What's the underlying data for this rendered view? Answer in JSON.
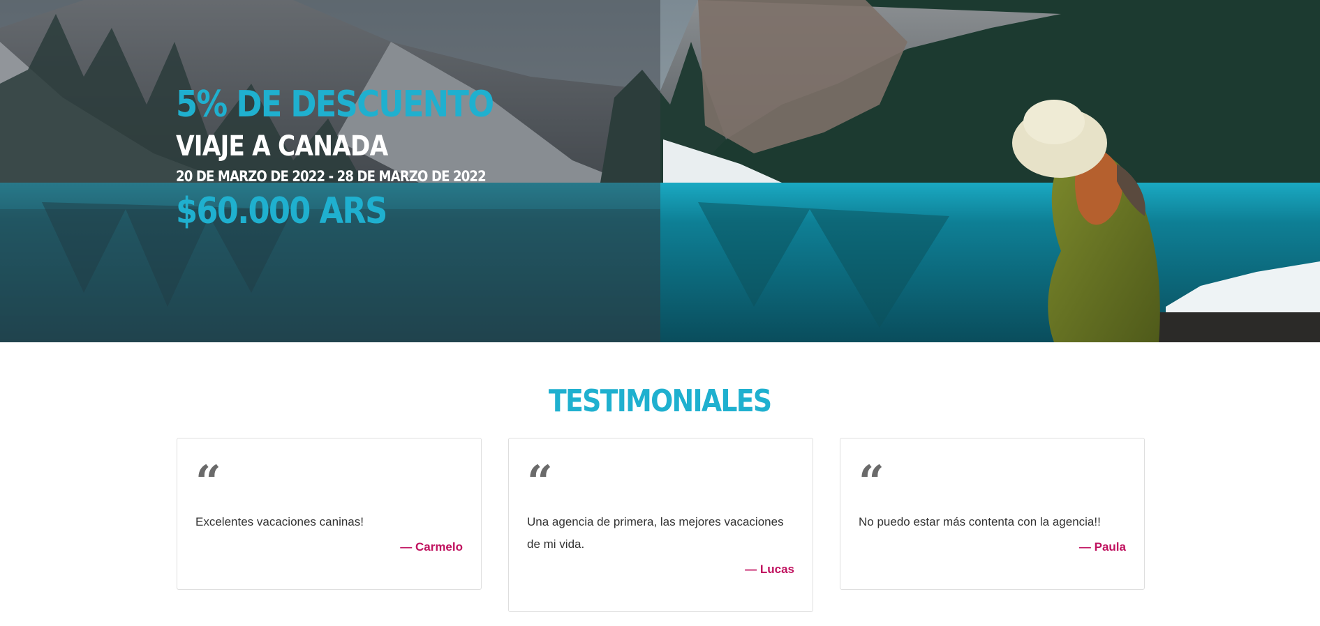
{
  "hero": {
    "discount": "5% DE DESCUENTO",
    "trip": "VIAJE A CANADA",
    "dates": "20 DE MARZO DE 2022 - 28 DE MARZO DE 2022",
    "price": "$60.000 ARS",
    "image": "lake-mountains-woman-photo"
  },
  "testimonials": {
    "title": "TESTIMONIALES",
    "quote_icon": "quote-icon",
    "items": [
      {
        "text": "Excelentes vacaciones caninas!",
        "author": "— Carmelo"
      },
      {
        "text": "Una agencia de primera, las mejores vacaciones de mi vida.",
        "author": "— Lucas"
      },
      {
        "text": "No puedo estar más contenta con la agencia!!",
        "author": "— Paula"
      }
    ]
  },
  "colors": {
    "accent": "#1fb0cf",
    "author": "#c0125f",
    "text": "#333333"
  }
}
